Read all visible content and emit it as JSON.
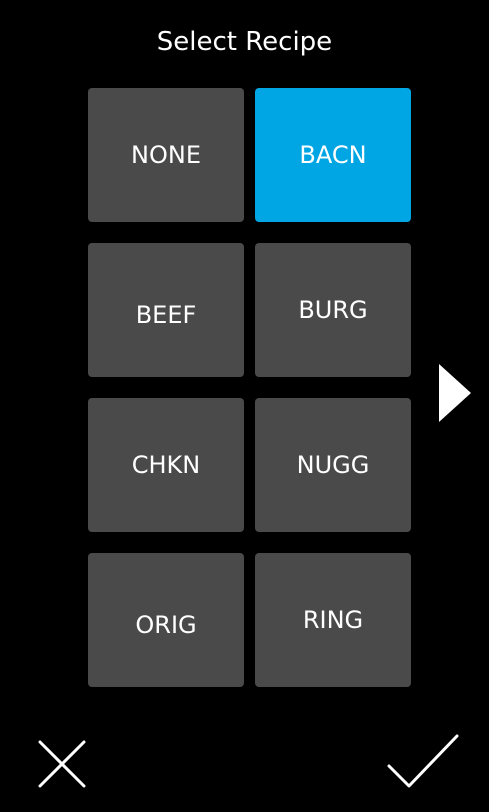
{
  "header": {
    "title": "Select Recipe"
  },
  "recipes": [
    {
      "label": "NONE",
      "selected": false
    },
    {
      "label": "BACN",
      "selected": true
    },
    {
      "label": "BEEF",
      "selected": false
    },
    {
      "label": "BURG",
      "selected": false
    },
    {
      "label": "CHKN",
      "selected": false
    },
    {
      "label": "NUGG",
      "selected": false
    },
    {
      "label": "ORIG",
      "selected": false
    },
    {
      "label": "RING",
      "selected": false
    }
  ],
  "icons": {
    "next": "chevron-right-icon",
    "cancel": "close-icon",
    "confirm": "checkmark-icon"
  },
  "colors": {
    "background": "#000000",
    "tile": "#4a4a4a",
    "tile_selected": "#00a5e3",
    "text": "#ffffff"
  }
}
